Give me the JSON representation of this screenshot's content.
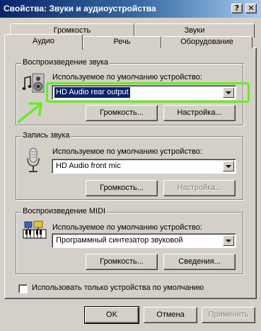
{
  "window": {
    "title": "Свойства: Звуки и аудиоустройства",
    "help_label": "?",
    "close_label": "✕"
  },
  "tabs": {
    "row1": [
      "Громкость",
      "Звуки"
    ],
    "row2": [
      "Аудио",
      "Речь",
      "Оборудование"
    ],
    "active": "Аудио"
  },
  "playback": {
    "group_label": "Воспроизведение звука",
    "device_label": "Используемое по умолчанию устройство:",
    "device_value": "HD Audio rear output",
    "volume_button": "Громкость...",
    "settings_button": "Настройка..."
  },
  "recording": {
    "group_label": "Запись звука",
    "device_label": "Используемое по умолчанию устройство:",
    "device_value": "HD Audio front mic",
    "volume_button": "Громкость...",
    "settings_button": "Настройка..."
  },
  "midi": {
    "group_label": "Воспроизведение MIDI",
    "device_label": "Используемое по умолчанию устройство:",
    "device_value": "Программный синтезатор звуковой",
    "volume_button": "Громкость...",
    "about_button": "Сведения..."
  },
  "use_default_only": {
    "label": "Использовать только устройства по умолчанию",
    "checked": false
  },
  "footer": {
    "ok": "OK",
    "cancel": "Отмена",
    "apply": "Применить"
  },
  "colors": {
    "annotation": "#66ee22",
    "selection": "#0a246a",
    "face": "#d4d0c8"
  },
  "icons": [
    "speaker-music-icon",
    "microphone-icon",
    "midi-keyboard-icon",
    "help-icon",
    "close-icon",
    "chevron-down-icon",
    "arrow-annotation-icon"
  ]
}
